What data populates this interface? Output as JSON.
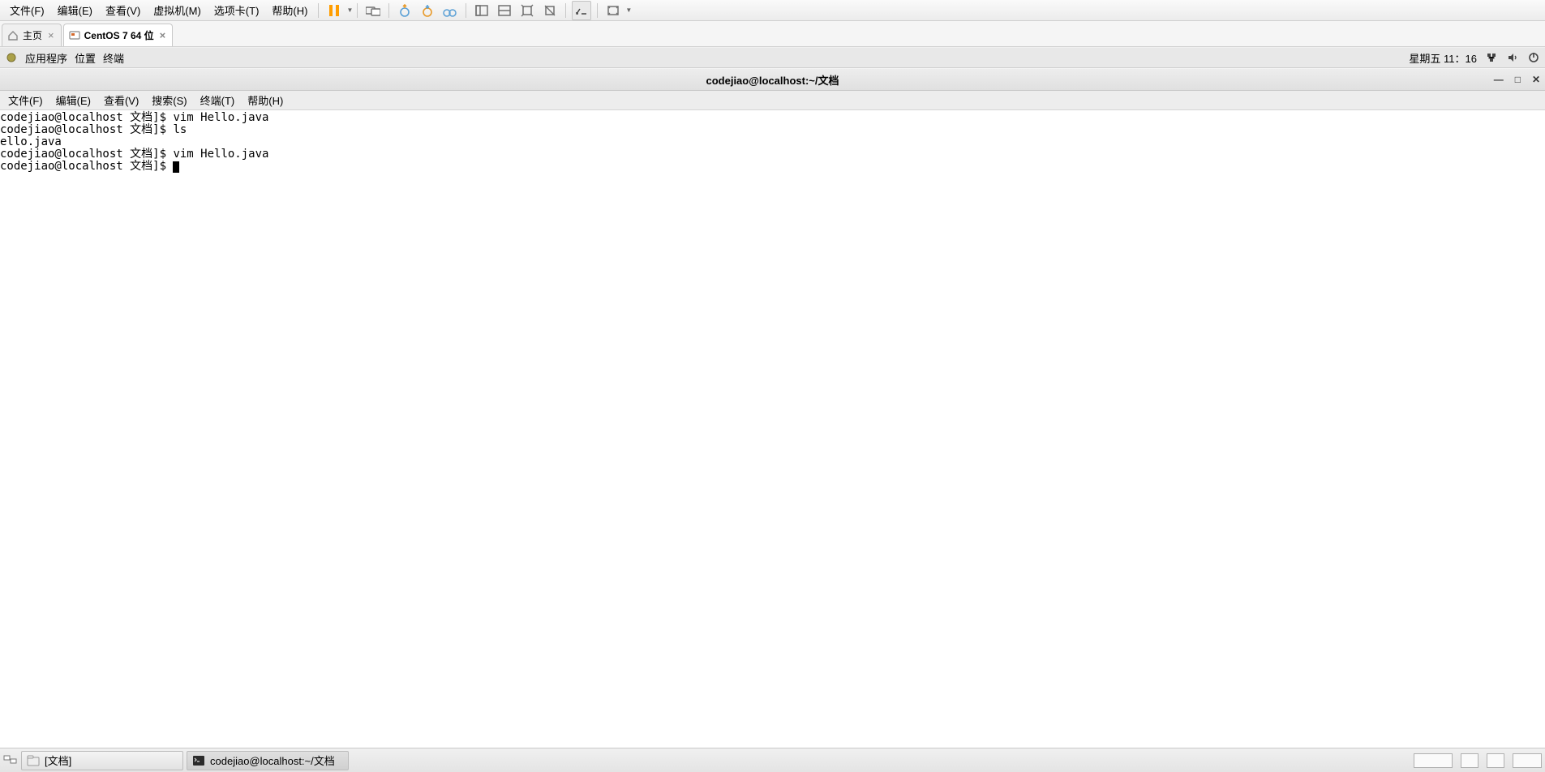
{
  "host_menu": {
    "file": "文件(F)",
    "edit": "编辑(E)",
    "view": "查看(V)",
    "vm": "虚拟机(M)",
    "tabs": "选项卡(T)",
    "help": "帮助(H)"
  },
  "host_tabs": {
    "home": "主页",
    "vm_active": "CentOS 7 64 位"
  },
  "guest_topbar": {
    "applications": "应用程序",
    "places": "位置",
    "terminal": "终端",
    "datetime": "星期五 11：16"
  },
  "guest_window": {
    "title": "codejiao@localhost:~/文档"
  },
  "term_menu": {
    "file": "文件(F)",
    "edit": "编辑(E)",
    "view": "查看(V)",
    "search": "搜索(S)",
    "terminal": "终端(T)",
    "help": "帮助(H)"
  },
  "terminal_lines": {
    "l0_prompt": "codejiao@localhost 文档]$ ",
    "l0_cmd": "vim Hello.java",
    "l1_prompt": "codejiao@localhost 文档]$ ",
    "l1_cmd": "ls",
    "l2": "ello.java",
    "l3_prompt": "codejiao@localhost 文档]$ ",
    "l3_cmd": "vim Hello.java",
    "l4_prompt": "codejiao@localhost 文档]$ "
  },
  "guest_panel": {
    "task_files": "[文档]",
    "task_terminal": "codejiao@localhost:~/文档"
  }
}
